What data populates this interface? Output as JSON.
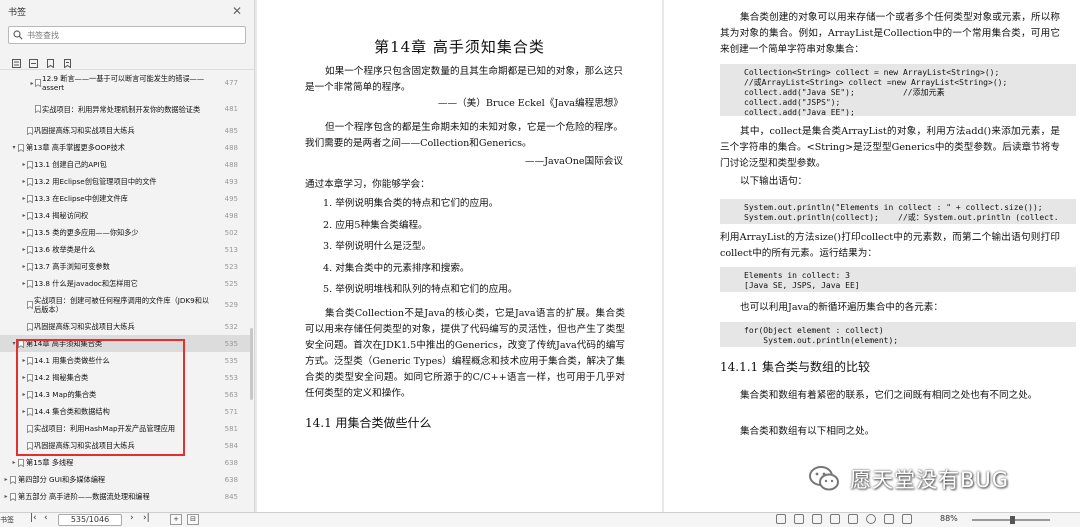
{
  "sidebar": {
    "title": "书签",
    "search_placeholder": "书签查找",
    "items": [
      {
        "level": 3,
        "toggle": "▸",
        "title": "12.9  断言——一基于可以断言可能发生的错误——assert",
        "page": "477",
        "two": true
      },
      {
        "level": 3,
        "toggle": "",
        "title": "实战项目：利用异常处理机制开发你的数据验证类",
        "page": "481",
        "two": true
      },
      {
        "level": 2,
        "toggle": "",
        "title": "巩固提高练习和实战项目大练兵",
        "page": "485"
      },
      {
        "level": 1,
        "toggle": "▾",
        "title": "第13章  高手掌握更多OOP技术",
        "page": "488"
      },
      {
        "level": 2,
        "toggle": "▸",
        "title": "13.1  创建自己的API包",
        "page": "488"
      },
      {
        "level": 2,
        "toggle": "▸",
        "title": "13.2  用Eclipse创包管理项目中的文件",
        "page": "493"
      },
      {
        "level": 2,
        "toggle": "▸",
        "title": "13.3  在Eclipse中创建文件库",
        "page": "495"
      },
      {
        "level": 2,
        "toggle": "▸",
        "title": "13.4  揭秘访问权",
        "page": "498"
      },
      {
        "level": 2,
        "toggle": "▸",
        "title": "13.5  类的更多应用——你知多少",
        "page": "502"
      },
      {
        "level": 2,
        "toggle": "▸",
        "title": "13.6  枚举类是什么",
        "page": "513"
      },
      {
        "level": 2,
        "toggle": "▸",
        "title": "13.7  高手浏知可变参数",
        "page": "523"
      },
      {
        "level": 2,
        "toggle": "▸",
        "title": "13.8  什么是javadoc和怎样用它",
        "page": "525"
      },
      {
        "level": 2,
        "toggle": "",
        "title": "实战项目：创建可被任何程序调用的文件库（JDK9和以后版本）",
        "page": "529",
        "two": true
      },
      {
        "level": 2,
        "toggle": "",
        "title": "巩固提高练习和实战项目大练兵",
        "page": "532"
      },
      {
        "level": 1,
        "toggle": "▾",
        "title": "第14章  高手须知集合类",
        "page": "535",
        "selected": true
      },
      {
        "level": 2,
        "toggle": "▸",
        "title": "14.1  用集合类做些什么",
        "page": "535"
      },
      {
        "level": 2,
        "toggle": "▸",
        "title": "14.2  揭秘集合类",
        "page": "553"
      },
      {
        "level": 2,
        "toggle": "▸",
        "title": "14.3  Map的集合类",
        "page": "563"
      },
      {
        "level": 2,
        "toggle": "▸",
        "title": "14.4  集合类和数据结构",
        "page": "571"
      },
      {
        "level": 2,
        "toggle": "",
        "title": "实战项目：利用HashMap开发产品管理应用",
        "page": "581"
      },
      {
        "level": 2,
        "toggle": "",
        "title": "巩固提高练习和实战项目大练兵",
        "page": "584"
      },
      {
        "level": 1,
        "toggle": "▸",
        "title": "第15章  多线程",
        "page": "638"
      },
      {
        "level": 0,
        "toggle": "▸",
        "title": "第四部分  GUI和多媒体编程",
        "page": "638"
      },
      {
        "level": 0,
        "toggle": "▸",
        "title": "第五部分  高手进阶——数据流处理和编程",
        "page": "845"
      }
    ]
  },
  "left_page": {
    "chapter_title": "第14章    高手须知集合类",
    "para1": "如果一个程序只包含固定数量的且其生命期都是已知的对象，那么这只是一个非常简单的程序。",
    "quote1": "——（美）Bruce Eckel《Java编程思想》",
    "para2": "但一个程序包含的都是生命期未知的未知对象，它是一个危险的程序。我们需要的是两者之间——Collection和Generics。",
    "quote2": "——JavaOne国际会议",
    "intro": "通过本章学习，你能够学会：",
    "list": [
      "1.  举例说明集合类的特点和它们的应用。",
      "2.  应用5种集合类编程。",
      "3.  举例说明什么是泛型。",
      "4.  对集合类中的元素排序和搜索。",
      "5.  举例说明堆栈和队列的特点和它们的应用。"
    ],
    "para3": "集合类Collection不是Java的核心类，它是Java语言的扩展。集合类可以用来存储任何类型的对象，提供了代码编写的灵活性，但也产生了类型安全问题。首次在JDK1.5中推出的Generics，改变了传统Java代码的编写方式。泛型类（Generic Types）编程概念和技术应用于集合类，解决了集合类的类型安全问题。如同它所源于的C/C++语言一样，也可用于几乎对任何类型的定义和操作。",
    "section": "14.1    用集合类做些什么"
  },
  "right_page": {
    "para1": "集合类创建的对象可以用来存储一个或者多个任何类型对象或元素，所以称其为对象的集合。例如，ArrayList是Collection中的一个常用集合类，可用它来创建一个简单字符串对象集合：",
    "code1": "Collection<String> collect = new ArrayList<String>();\n//或ArrayList<String> collect =new ArrayList<String>();\ncollect.add(\"Java SE\");          //添加元素\ncollect.add(\"JSPS\");\ncollect.add(\"Java EE\");",
    "para2": "其中，collect是集合类ArrayList的对象，利用方法add()来添加元素，是三个字符串的集合。<String>是泛型型Generics中的类型参数。后读章节将专门讨论泛型和类型参数。",
    "para3": "以下输出语句：",
    "code2": "System.out.println(\"Elements in collect : \" + collect.size());\nSystem.out.println(collect);    //或：System.out.println (collect.",
    "para4": "利用ArrayList的方法size()打印collect中的元素数，而第二个输出语句则打印collect中的所有元素。运行结果为：",
    "code3": "Elements in collect: 3\n[Java SE, JSPS, Java EE]",
    "para5": "也可以利用Java的新循环遍历集合中的各元素：",
    "code4": "for(Object element : collect)\n    System.out.println(element);",
    "section": "14.1.1    集合类与数组的比较",
    "para6": "集合类和数组有着紧密的联系，它们之间既有相同之处也有不同之处。",
    "para7": "集合类和数组有以下相同之处。"
  },
  "watermark": "愿天堂没有BUG",
  "status": {
    "left_label": "书签",
    "page_field": "535/1046",
    "zoom": "88%"
  }
}
